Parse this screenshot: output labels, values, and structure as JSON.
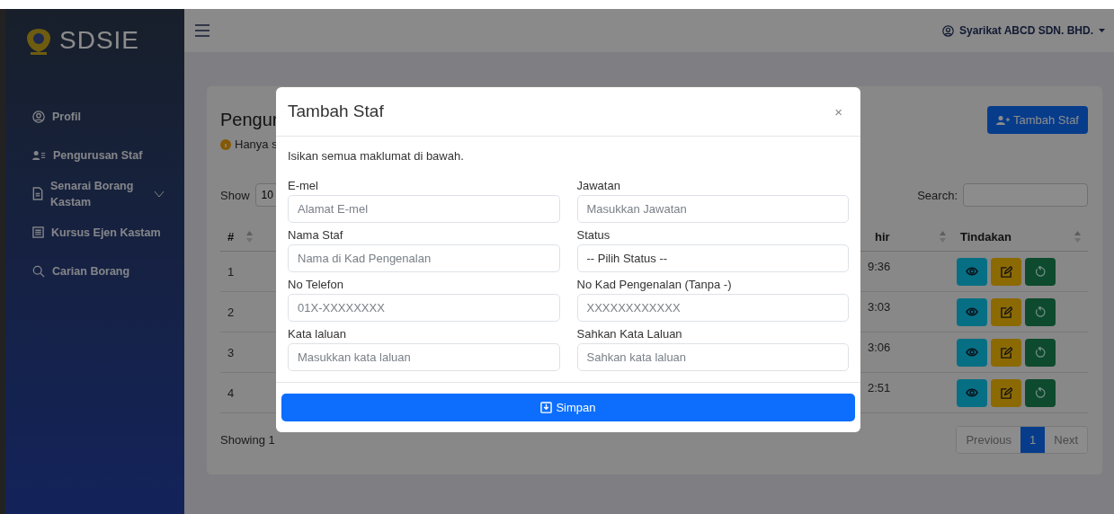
{
  "sidebar": {
    "logo": "SDSIE",
    "items": [
      {
        "label": "Profil"
      },
      {
        "label": "Pengurusan Staf"
      },
      {
        "label": "Senarai Borang Kastam",
        "expanded": false
      },
      {
        "label": "Kursus Ejen Kastam"
      },
      {
        "label": "Carian Borang"
      }
    ]
  },
  "topbar": {
    "user": "Syarikat ABCD SDN. BHD."
  },
  "page": {
    "title": "Pengur",
    "note": "Hanya s",
    "add_button": "Tambah Staf",
    "show_label": "Show",
    "page_length": "10",
    "search_label": "Search:",
    "columns": [
      "#",
      "hir",
      "Tindakan"
    ],
    "rows": [
      {
        "number": "1",
        "column_3": "9:36"
      },
      {
        "number": "2",
        "column_3": "3:03"
      },
      {
        "number": "3",
        "column_3": "3:06"
      },
      {
        "number": "4",
        "column_3": "2:51"
      }
    ],
    "info": "Showing 1",
    "previous": "Previous",
    "pages": [
      {
        "label": "1",
        "selected": true
      }
    ],
    "next": "Next"
  },
  "modal": {
    "title": "Tambah Staf",
    "close": "×",
    "intro": "Isikan semua maklumat di bawah.",
    "fields": [
      {
        "label": "E-mel",
        "placeholder": "Alamat E-mel",
        "kind": "input"
      },
      {
        "label": "Jawatan",
        "placeholder": "Masukkan Jawatan",
        "kind": "input"
      },
      {
        "label": "Nama Staf",
        "placeholder": "Nama di Kad Pengenalan",
        "kind": "input"
      },
      {
        "label": "Status",
        "value": "-- Pilih Status --",
        "kind": "select"
      },
      {
        "label": "No Telefon",
        "placeholder": "01X-XXXXXXXX",
        "kind": "input"
      },
      {
        "label": "No Kad Pengenalan (Tanpa -)",
        "placeholder": "XXXXXXXXXXXX",
        "kind": "input"
      },
      {
        "label": "Kata laluan",
        "placeholder": "Masukkan kata laluan",
        "kind": "input"
      },
      {
        "label": "Sahkan Kata Laluan",
        "placeholder": "Sahkan kata laluan",
        "kind": "input"
      }
    ],
    "submit": "Simpan"
  }
}
